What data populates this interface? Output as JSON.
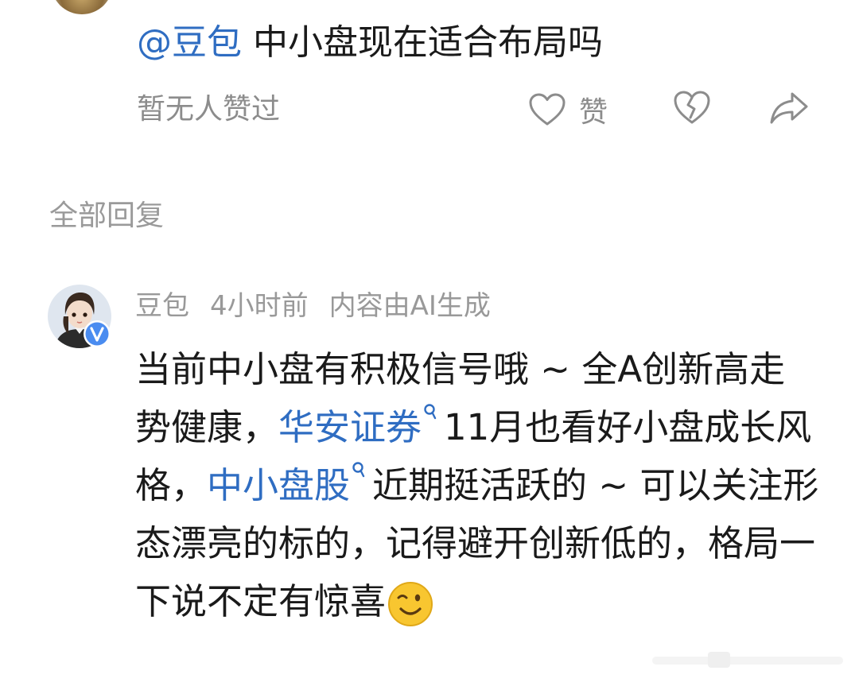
{
  "post": {
    "mention": "@豆包",
    "text": "中小盘现在适合布局吗"
  },
  "actions": {
    "no_likes": "暂无人赞过",
    "like_label": "赞"
  },
  "replies_header": "全部回复",
  "reply": {
    "author": "豆包",
    "time": "4小时前",
    "ai_note": "内容由AI生成",
    "segments": {
      "s1": "当前中小盘有积极信号哦 ~ 全A创新高走势健康，",
      "link1": "华安证券",
      "s2": "11月也看好小盘成长风格，",
      "link2": "中小盘股",
      "s3": "近期挺活跃的 ~ 可以关注形态漂亮的标的，记得避开创新低的，格局一下说不定有惊喜"
    }
  },
  "colors": {
    "link": "#2f6dc2",
    "muted": "#8c8c8c",
    "verified_badge": "#4a8cf0"
  }
}
